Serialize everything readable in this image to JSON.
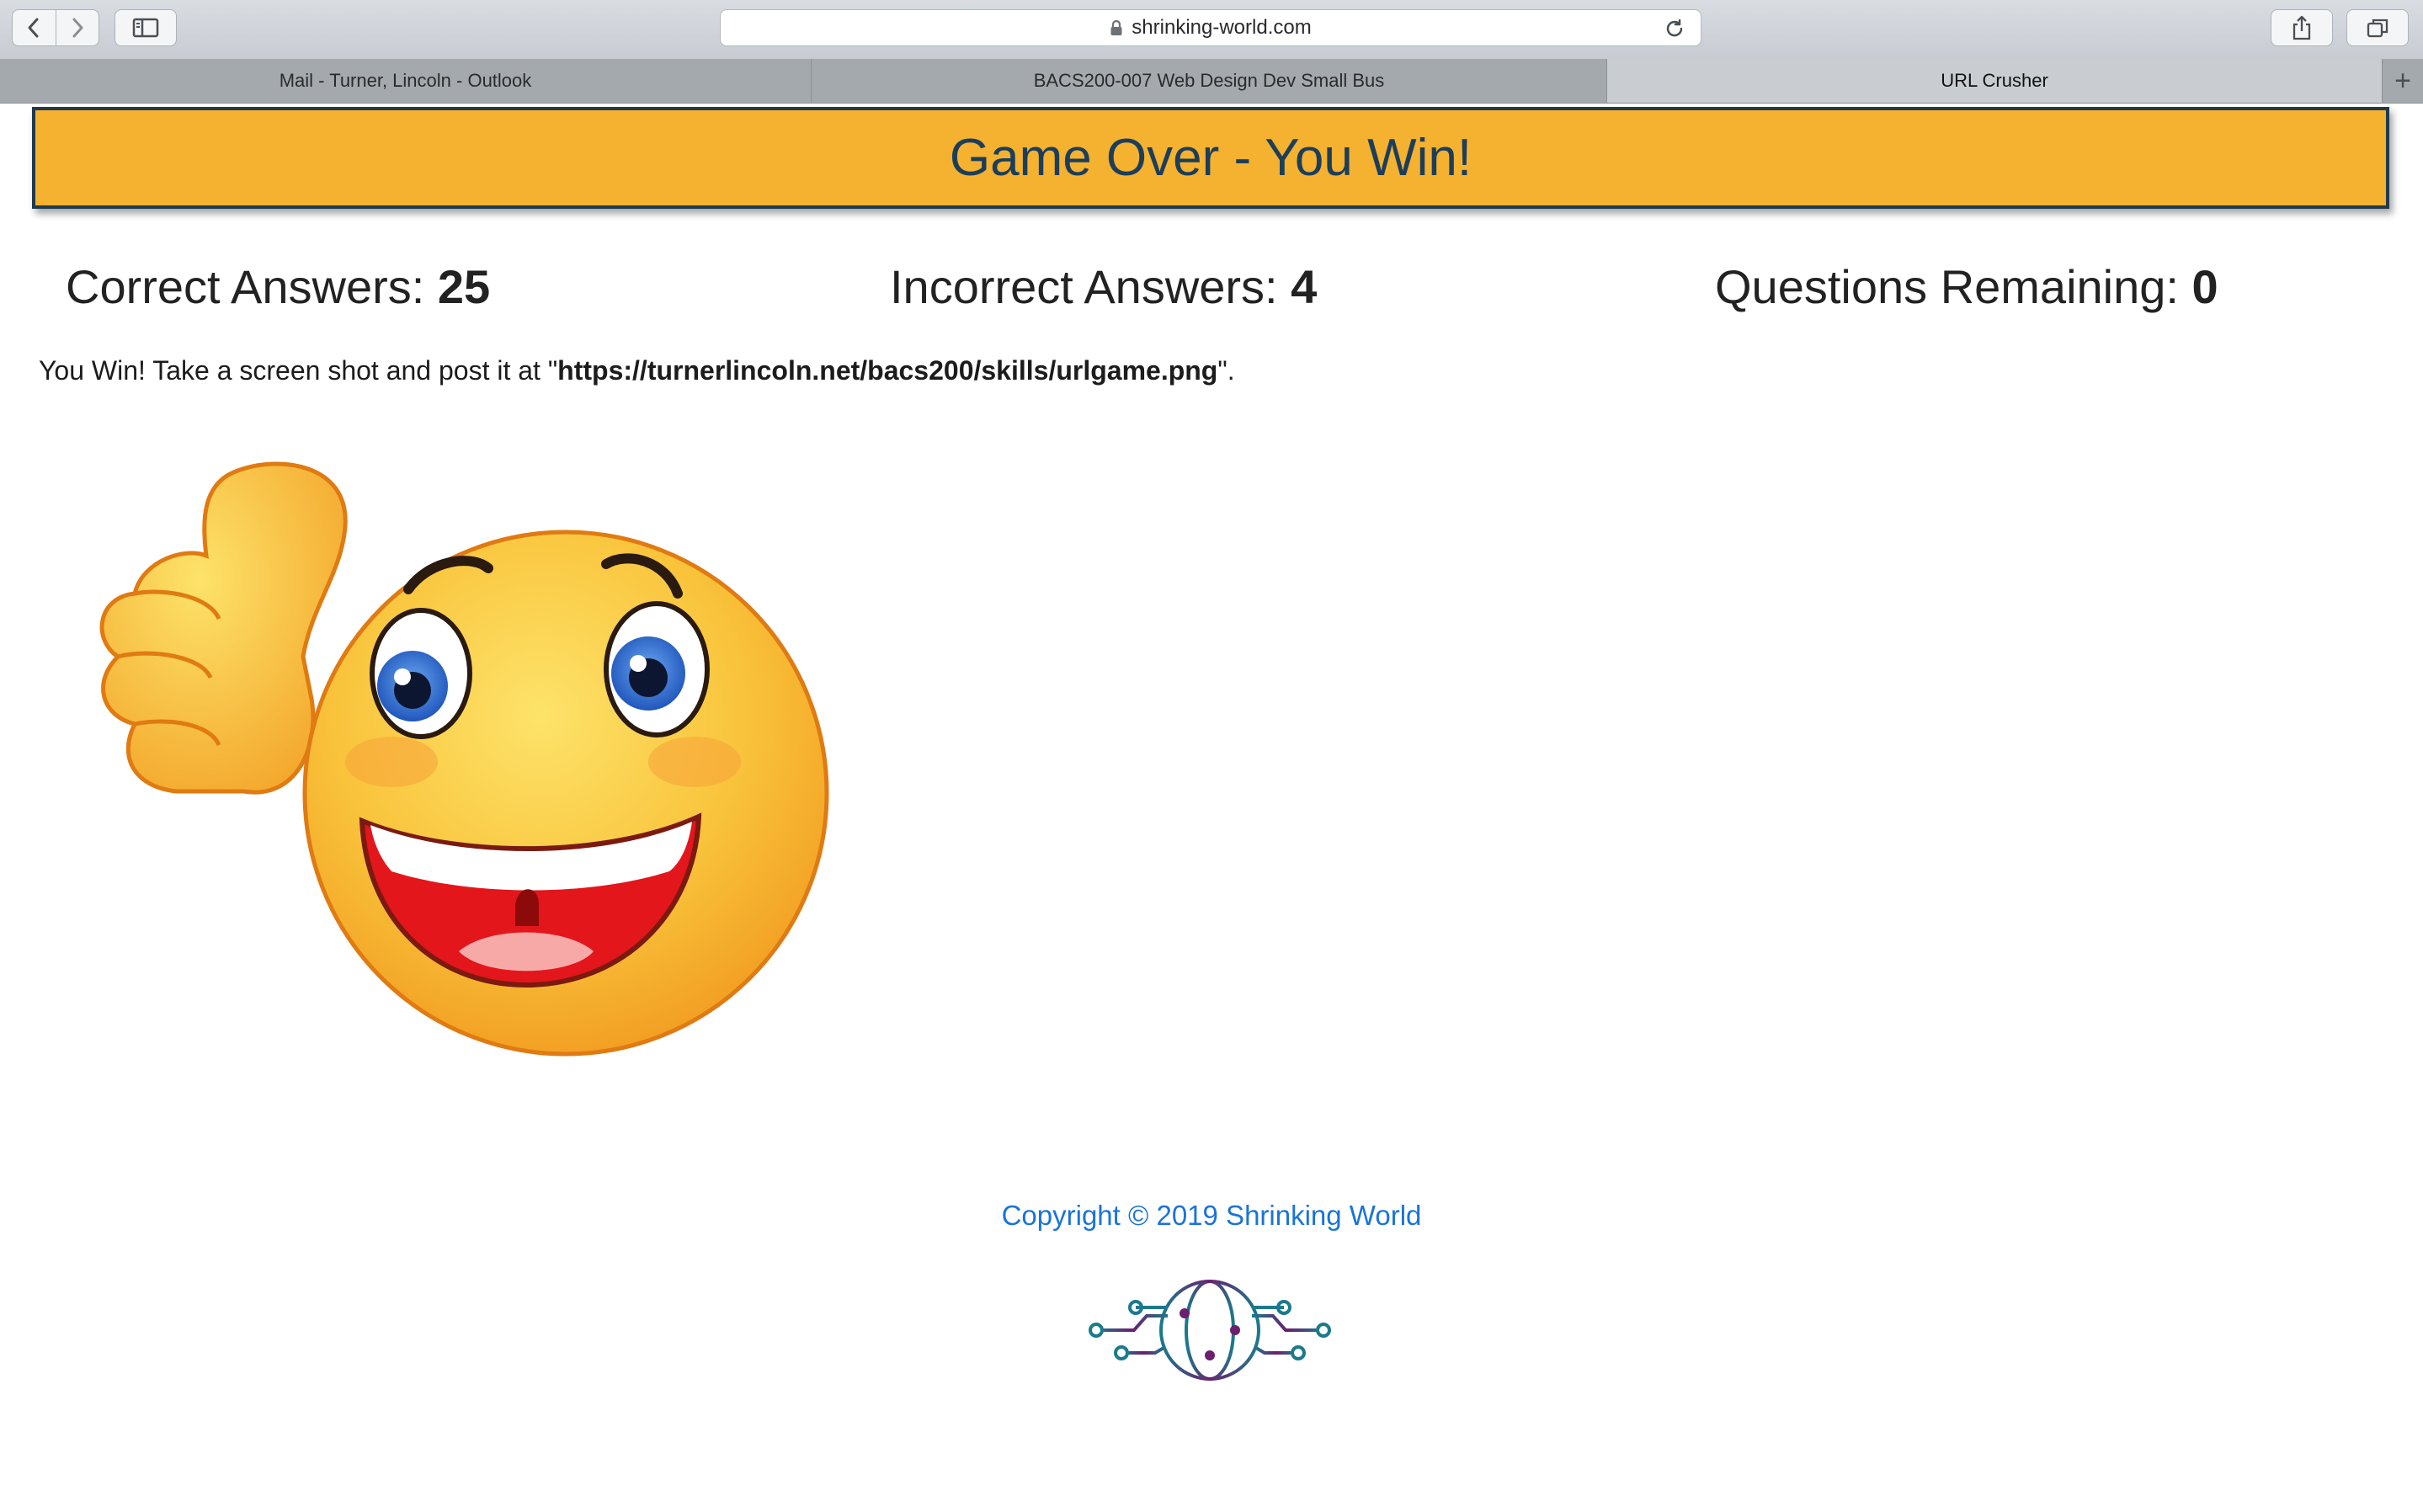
{
  "browser": {
    "url": "shrinking-world.com",
    "tabs": [
      {
        "label": "Mail - Turner, Lincoln - Outlook",
        "active": false
      },
      {
        "label": "BACS200-007 Web Design Dev Small Bus",
        "active": false
      },
      {
        "label": "URL Crusher",
        "active": true
      }
    ],
    "new_tab_label": "+"
  },
  "page": {
    "banner_title": "Game Over - You Win!",
    "stats": [
      {
        "label": "Correct Answers: ",
        "value": "25"
      },
      {
        "label": "Incorrect Answers: ",
        "value": "4"
      },
      {
        "label": "Questions Remaining: ",
        "value": "0"
      }
    ],
    "message": {
      "prefix": "You Win! Take a screen shot and post it at \"",
      "url": "https://turnerlincoln.net/bacs200/skills/urlgame.png",
      "suffix": "\"."
    },
    "footer": "Copyright © 2019 Shrinking World"
  },
  "colors": {
    "banner_bg": "#f5b130",
    "banner_border": "#1f3a4e",
    "banner_text": "#1c3e5a",
    "link": "#1a73d9"
  },
  "icons": [
    "back-icon",
    "forward-icon",
    "sidebar-icon",
    "lock-icon",
    "reload-icon",
    "share-icon",
    "tabs-overview-icon",
    "thumbs-up-smiley-image",
    "shrinking-world-logo"
  ]
}
